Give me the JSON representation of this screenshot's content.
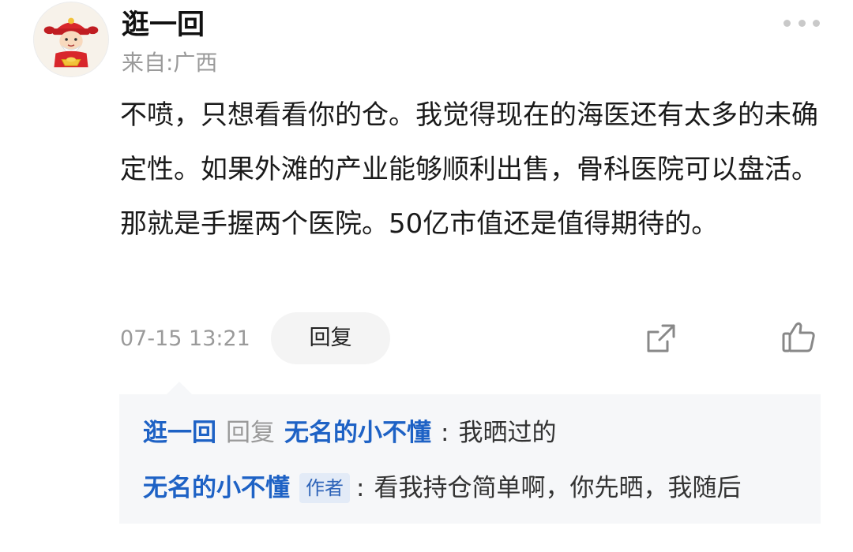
{
  "post": {
    "username": "逛一回",
    "location": "来自:广西",
    "content": "不喷，只想看看你的仓。我觉得现在的海医还有太多的未确定性。如果外滩的产业能够顺利出售，骨科医院可以盘活。那就是手握两个医院。50亿市值还是值得期待的。",
    "timestamp": "07-15 13:21",
    "reply_label": "回复",
    "avatar_icon": "caishen-avatar-icon",
    "more_icon": "more-dots-icon",
    "share_icon": "share-icon",
    "like_icon": "thumbs-up-icon"
  },
  "replies": [
    {
      "from": "逛一回",
      "reply_word": "回复",
      "to": "无名的小不懂",
      "separator": ":",
      "text": "我晒过的"
    },
    {
      "from": "无名的小不懂",
      "badge": "作者",
      "separator": ":",
      "text": "看我持仓简单啊，你先晒，我随后"
    }
  ],
  "colors": {
    "link": "#1e62c5",
    "muted": "#9a9a9a",
    "reply_bg": "#f6f7f9",
    "badge_bg": "#e3ebf7"
  }
}
